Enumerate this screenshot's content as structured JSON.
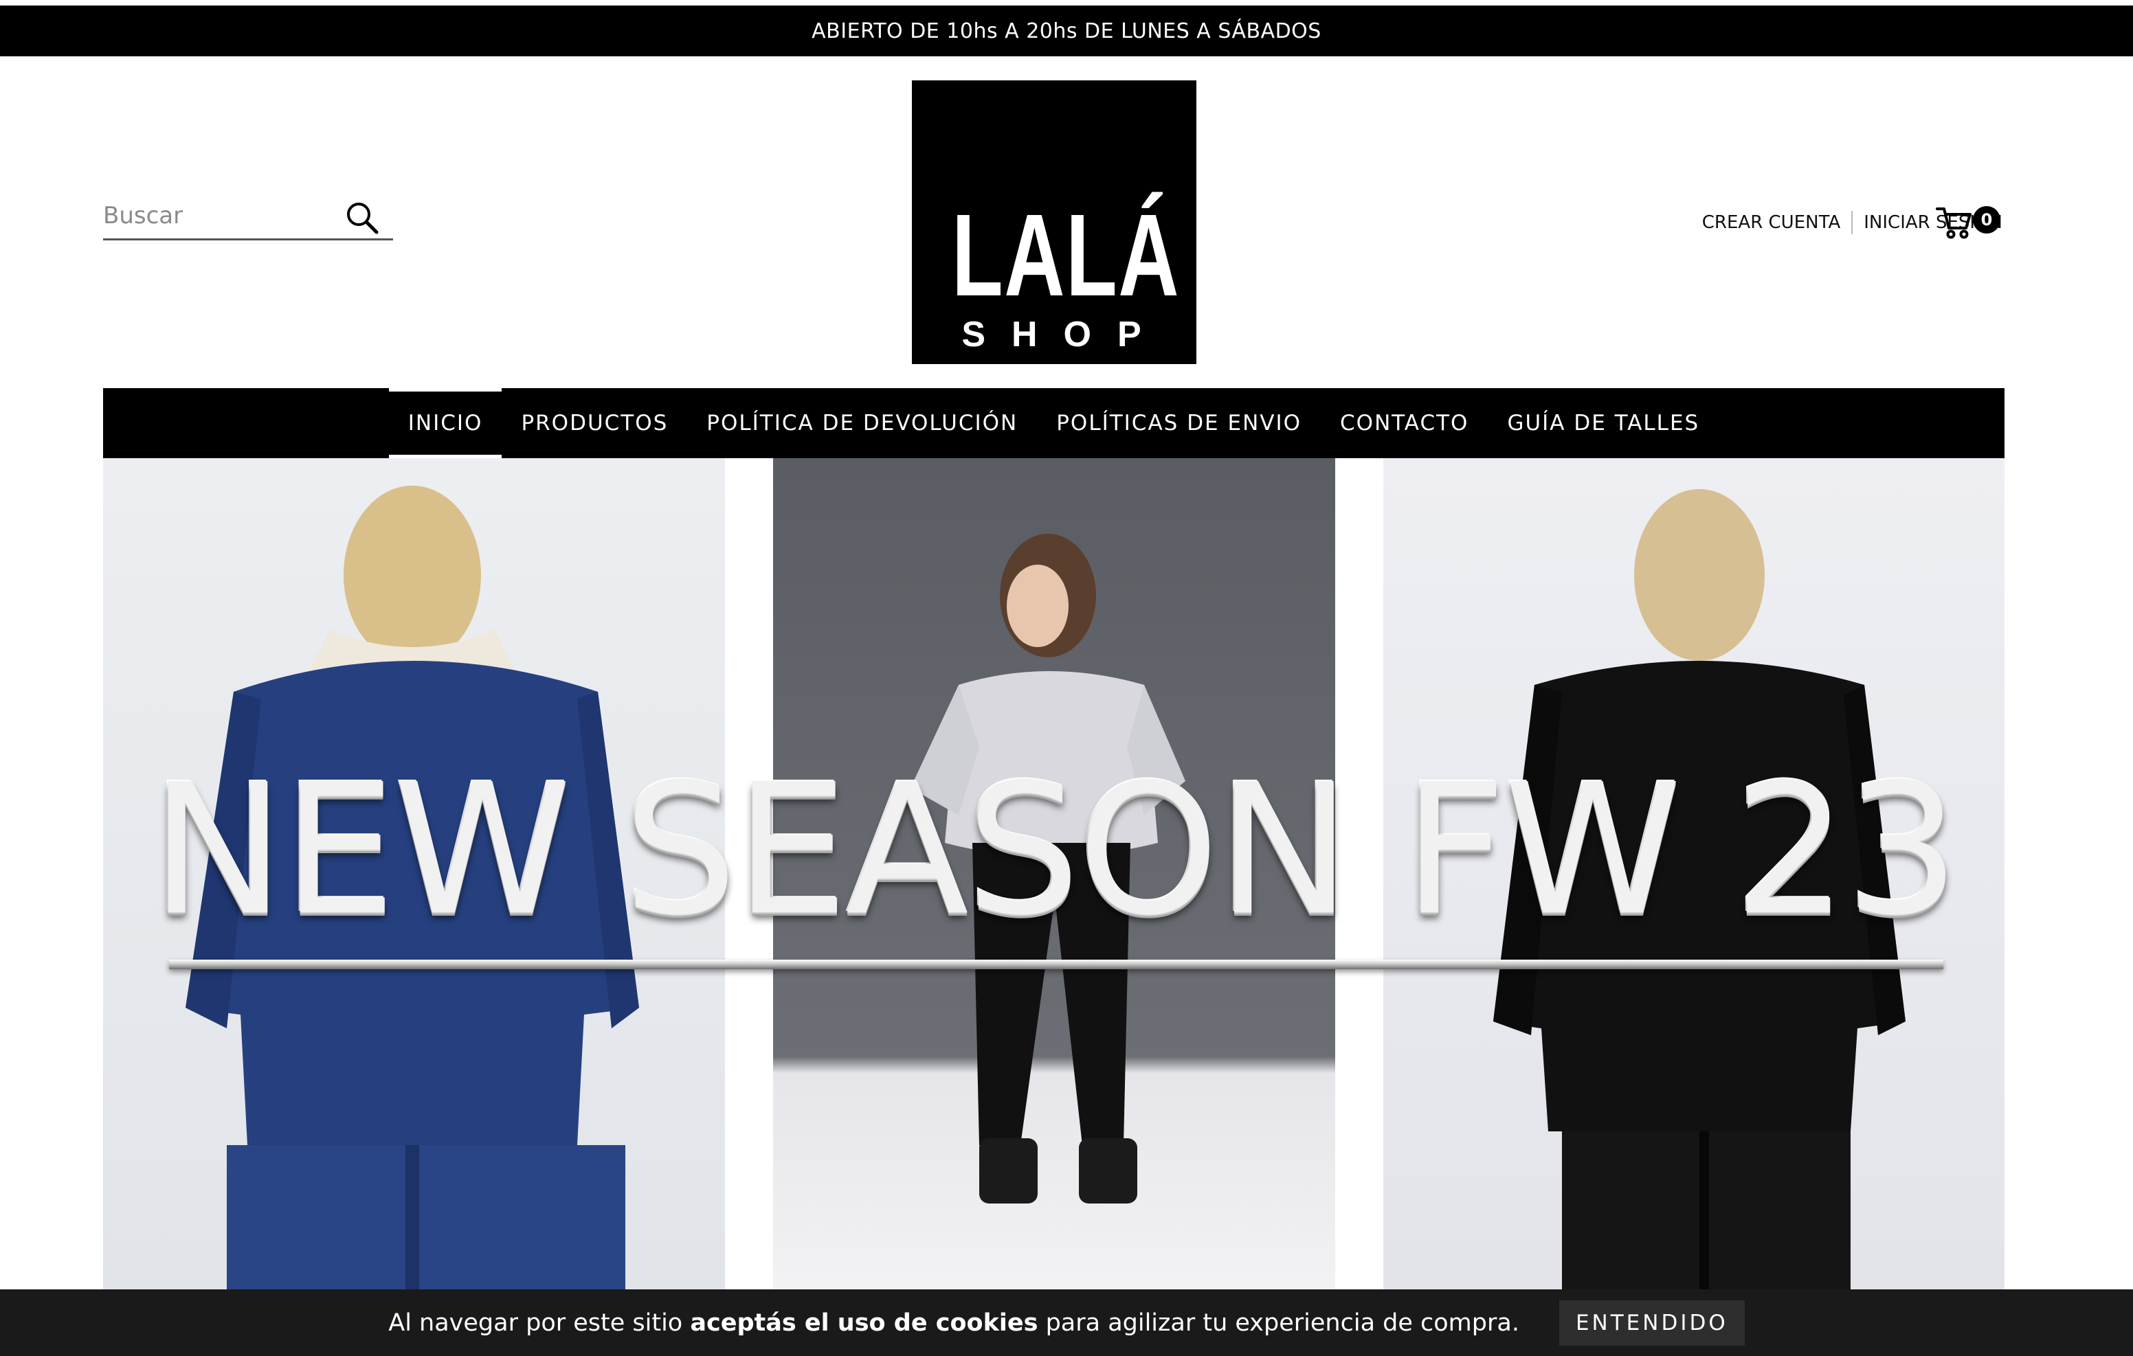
{
  "announcement": "ABIERTO DE 10hs A 20hs DE LUNES A SÁBADOS",
  "search": {
    "placeholder": "Buscar"
  },
  "logo": {
    "main": "LALÁ",
    "sub": "SHOP"
  },
  "account": {
    "create": "CREAR CUENTA",
    "login": "INICIAR SESIÓN"
  },
  "cart": {
    "count": "0"
  },
  "nav": [
    {
      "label": "INICIO",
      "active": true
    },
    {
      "label": "PRODUCTOS"
    },
    {
      "label": "POLÍTICA DE DEVOLUCIÓN"
    },
    {
      "label": "POLÍTICAS DE ENVIO"
    },
    {
      "label": "CONTACTO"
    },
    {
      "label": "GUÍA DE TALLES"
    }
  ],
  "hero": {
    "title": "NEW SEASON FW 23"
  },
  "cookie": {
    "text_before": "Al navegar por este sitio ",
    "text_bold": "aceptás el uso de cookies",
    "text_after": " para agilizar tu experiencia de compra.",
    "button": "ENTENDIDO"
  },
  "colors": {
    "bar": "#000000",
    "cookie_bg": "#1a1a1a"
  }
}
